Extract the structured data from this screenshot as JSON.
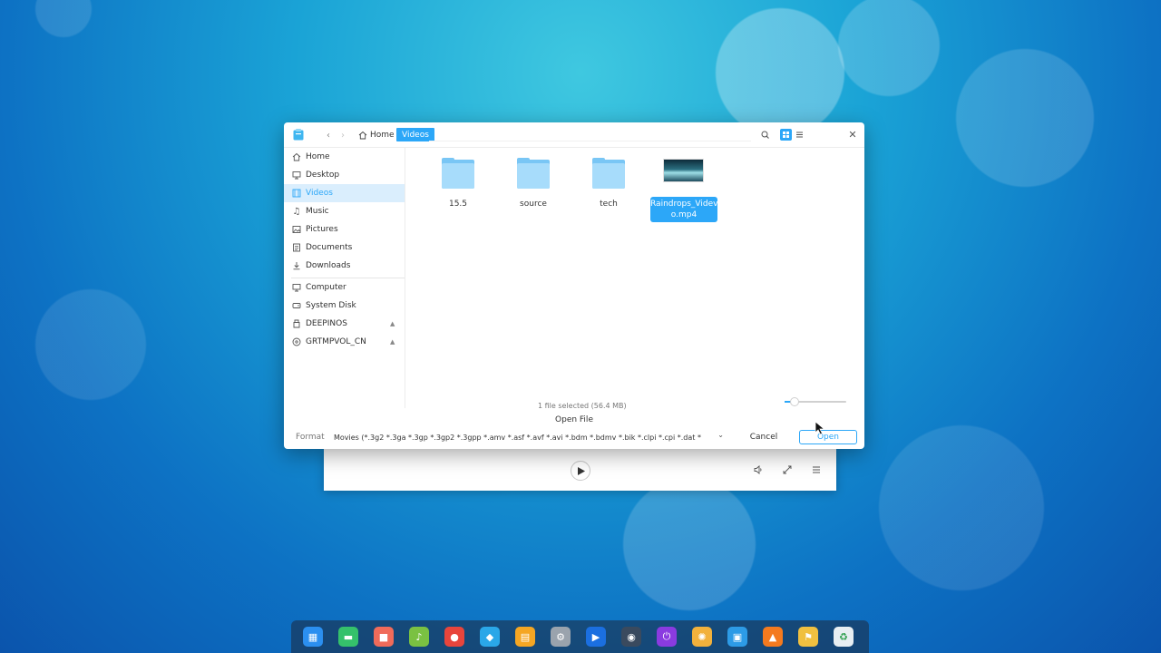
{
  "player": {
    "play_label": "play",
    "icons": [
      "play-icon",
      "volume-icon",
      "fullscreen-icon",
      "playlist-icon"
    ]
  },
  "dialog": {
    "title": "Open File",
    "breadcrumb": {
      "home": "Home",
      "current": "Videos"
    },
    "sidebar": {
      "groups": [
        [
          {
            "label": "Home",
            "icon": "home-icon"
          },
          {
            "label": "Desktop",
            "icon": "desktop-icon"
          },
          {
            "label": "Videos",
            "icon": "video-icon",
            "active": true
          },
          {
            "label": "Music",
            "icon": "music-icon"
          },
          {
            "label": "Pictures",
            "icon": "picture-icon"
          },
          {
            "label": "Documents",
            "icon": "document-icon"
          },
          {
            "label": "Downloads",
            "icon": "download-icon"
          }
        ],
        [
          {
            "label": "Computer",
            "icon": "computer-icon"
          },
          {
            "label": "System Disk",
            "icon": "disk-icon"
          },
          {
            "label": "DEEPINOS",
            "icon": "drive-icon",
            "eject": true
          },
          {
            "label": "GRTMPVOL_CN",
            "icon": "optical-disc-icon",
            "eject": true
          }
        ]
      ]
    },
    "files": [
      {
        "name": "15.5",
        "type": "folder"
      },
      {
        "name": "source",
        "type": "folder"
      },
      {
        "name": "tech",
        "type": "folder"
      },
      {
        "name": "Raindrops_Videvo.mp4",
        "name_line1": "Raindrops_Videv",
        "name_line2": "o.mp4",
        "type": "video",
        "selected": true
      }
    ],
    "status": "1 file selected (56.4 MB)",
    "icon_size_level": 0.15,
    "format_label": "Format",
    "format_value": "Movies (*.3g2 *.3ga *.3gp *.3gp2 *.3gpp *.amv *.asf *.avf *.avi *.bdm *.bdmv *.bik *.clpi *.cpi *.dat *",
    "cancel_label": "Cancel",
    "open_label": "Open"
  },
  "colors": {
    "accent": "#2ca7f8",
    "selection_bg": "#daeefd"
  },
  "dock": {
    "apps": [
      {
        "name": "launcher",
        "color": "#2b8ff0",
        "glyph": "▦"
      },
      {
        "name": "terminal",
        "color": "#35c16b",
        "glyph": "▬"
      },
      {
        "name": "screenshot",
        "color": "#f06b5a",
        "glyph": "■"
      },
      {
        "name": "music",
        "color": "#7ac142",
        "glyph": "♪"
      },
      {
        "name": "browser",
        "color": "#e8453c",
        "glyph": "●"
      },
      {
        "name": "app-store",
        "color": "#2aa7e8",
        "glyph": "◆"
      },
      {
        "name": "file-manager",
        "color": "#f5a623",
        "glyph": "▤"
      },
      {
        "name": "settings",
        "color": "#9aa3ad",
        "glyph": "⚙"
      },
      {
        "name": "video",
        "color": "#1b6fe0",
        "glyph": "▶"
      },
      {
        "name": "camera",
        "color": "#3a4a5e",
        "glyph": "◉"
      },
      {
        "name": "power",
        "color": "#8a3be0",
        "glyph": "⏻"
      },
      {
        "name": "assistant",
        "color": "#f2b13c",
        "glyph": "✺"
      },
      {
        "name": "monitor",
        "color": "#2d9be6",
        "glyph": "▣"
      },
      {
        "name": "uploader",
        "color": "#f47a1f",
        "glyph": "▲"
      },
      {
        "name": "tools",
        "color": "#f0c040",
        "glyph": "⚑"
      },
      {
        "name": "trash",
        "color": "#e8eef2",
        "glyph": "♻"
      }
    ]
  }
}
